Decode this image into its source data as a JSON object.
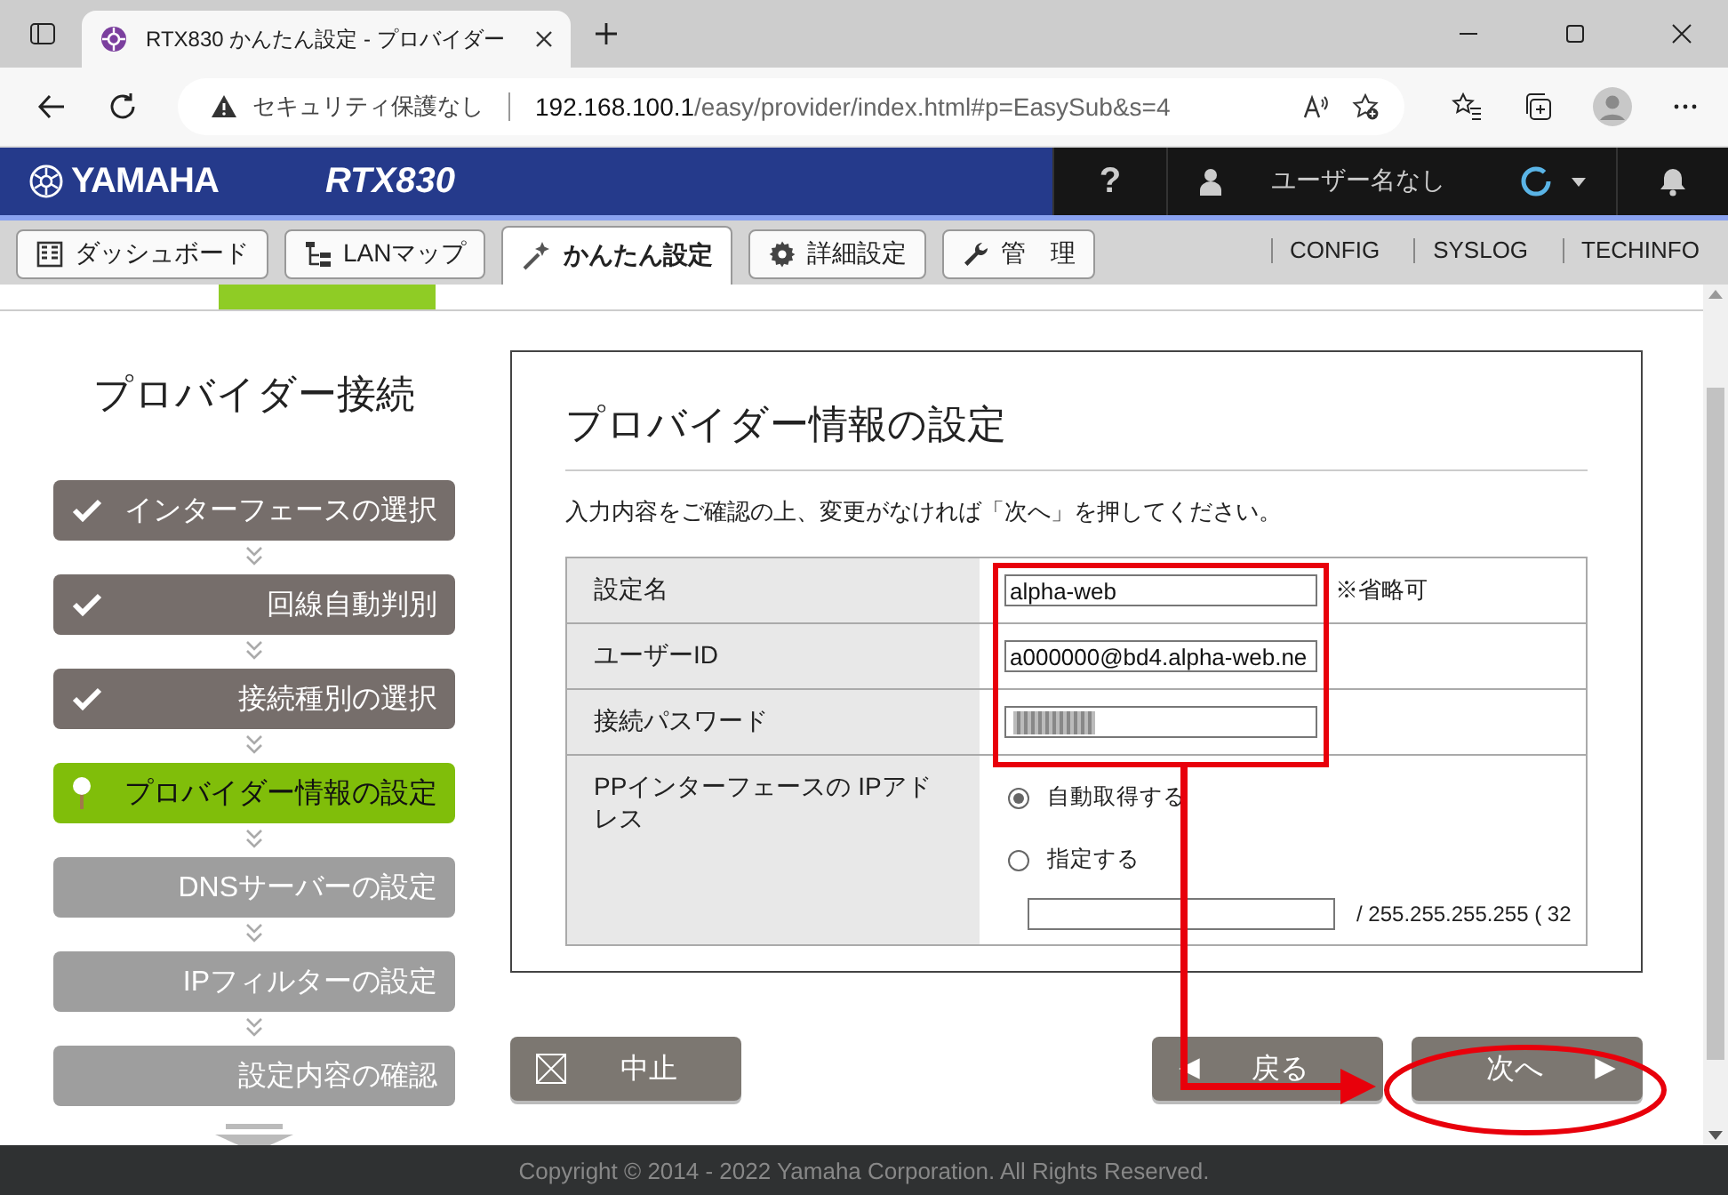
{
  "browser": {
    "tab_title": "RTX830 かんたん設定 - プロバイダー",
    "security_label": "セキュリティ保護なし",
    "url_host": "192.168.100.1",
    "url_path": "/easy/provider/index.html#p=EasySub&s=4"
  },
  "header": {
    "brand": "YAMAHA",
    "model": "RTX830",
    "help": "?",
    "user": "ユーザー名なし"
  },
  "nav_tabs": [
    {
      "label": "ダッシュボード",
      "selected": false
    },
    {
      "label": "LANマップ",
      "selected": false
    },
    {
      "label": "かんたん設定",
      "selected": true
    },
    {
      "label": "詳細設定",
      "selected": false
    },
    {
      "label": "管　理",
      "selected": false
    }
  ],
  "nav_links": [
    "CONFIG",
    "SYSLOG",
    "TECHINFO"
  ],
  "wizard": {
    "title": "プロバイダー接続",
    "steps": [
      {
        "label": "インターフェースの選択",
        "kind": "done"
      },
      {
        "label": "回線自動判別",
        "kind": "done"
      },
      {
        "label": "接続種別の選択",
        "kind": "done"
      },
      {
        "label": "プロバイダー情報の設定",
        "kind": "current"
      },
      {
        "label": "DNSサーバーの設定",
        "kind": "pending"
      },
      {
        "label": "IPフィルターの設定",
        "kind": "pending"
      },
      {
        "label": "設定内容の確認",
        "kind": "pending"
      }
    ]
  },
  "form": {
    "title": "プロバイダー情報の設定",
    "instruction": "入力内容をご確認の上、変更がなければ「次へ」を押してください。",
    "fields": [
      {
        "label": "設定名",
        "kind": "text",
        "value": "alpha-web",
        "note": "※省略可"
      },
      {
        "label": "ユーザーID",
        "kind": "text",
        "value": "a000000@bd4.alpha-web.ne"
      },
      {
        "label": "接続パスワード",
        "kind": "password"
      }
    ],
    "ip": {
      "label": "PPインターフェースの IPアドレス",
      "options": [
        {
          "label": "自動取得する",
          "selected": true
        },
        {
          "label": "指定する",
          "selected": false
        }
      ],
      "mask": "/ 255.255.255.255 ( 32"
    }
  },
  "buttons": [
    {
      "label": "中止",
      "kind": "cancel"
    },
    {
      "label": "戻る",
      "kind": "back"
    },
    {
      "label": "次へ",
      "kind": "next"
    }
  ],
  "footer": "Copyright © 2014 - 2022 Yamaha Corporation. All Rights Reserved."
}
